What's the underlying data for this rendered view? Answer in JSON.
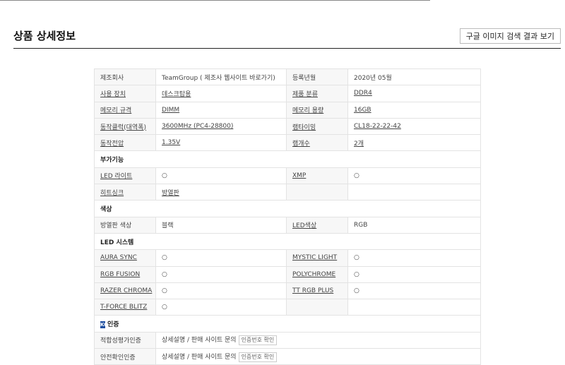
{
  "header": {
    "title": "상품 상세정보",
    "google_button": "구글 이미지 검색 결과 보기"
  },
  "rows": [
    {
      "type": "pair",
      "l1": "제조회사",
      "v1": "TeamGroup ( 제조사 웹사이트 바로가기)",
      "l2": "등록년월",
      "v2": "2020년 05월",
      "l1u": false,
      "v1u": false,
      "l2u": false,
      "v2u": false
    },
    {
      "type": "pair",
      "l1": "사용 장치",
      "v1": "데스크탑용",
      "l2": "제품 분류",
      "v2": "DDR4",
      "l1u": true,
      "v1u": true,
      "l2u": true,
      "v2u": true
    },
    {
      "type": "pair",
      "l1": "메모리 규격",
      "v1": "DIMM",
      "l2": "메모리 용량",
      "v2": "16GB",
      "l1u": true,
      "v1u": true,
      "l2u": true,
      "v2u": true
    },
    {
      "type": "pair",
      "l1": "동작클럭(대역폭)",
      "v1": "3600MHz (PC4-28800)",
      "l2": "램타이밍",
      "v2": "CL18-22-22-42",
      "l1u": true,
      "v1u": true,
      "l2u": true,
      "v2u": true
    },
    {
      "type": "pair",
      "l1": "동작전압",
      "v1": "1.35V",
      "l2": "램개수",
      "v2": "2개",
      "l1u": true,
      "v1u": true,
      "l2u": true,
      "v2u": true
    },
    {
      "type": "section",
      "title": "부가기능"
    },
    {
      "type": "pair",
      "l1": "LED 라이트",
      "v1": "○",
      "l2": "XMP",
      "v2": "○",
      "l1u": true,
      "v1u": false,
      "l2u": true,
      "v2u": false
    },
    {
      "type": "pair",
      "l1": "히트싱크",
      "v1": "방열판",
      "l2": "",
      "v2": "",
      "l1u": true,
      "v1u": true,
      "l2u": false,
      "v2u": false
    },
    {
      "type": "section",
      "title": "색상"
    },
    {
      "type": "pair",
      "l1": "방열판 색상",
      "v1": "블랙",
      "l2": "LED색상",
      "v2": "RGB",
      "l1u": false,
      "v1u": false,
      "l2u": true,
      "v2u": false
    },
    {
      "type": "section",
      "title": "LED 시스템"
    },
    {
      "type": "pair",
      "l1": "AURA SYNC",
      "v1": "○",
      "l2": "MYSTIC LIGHT",
      "v2": "○",
      "l1u": true,
      "v1u": false,
      "l2u": true,
      "v2u": false
    },
    {
      "type": "pair",
      "l1": "RGB FUSION",
      "v1": "○",
      "l2": "POLYCHROME",
      "v2": "○",
      "l1u": true,
      "v1u": false,
      "l2u": true,
      "v2u": false
    },
    {
      "type": "pair",
      "l1": "RAZER CHROMA",
      "v1": "○",
      "l2": "TT RGB PLUS",
      "v2": "○",
      "l1u": true,
      "v1u": false,
      "l2u": true,
      "v2u": false
    },
    {
      "type": "pair",
      "l1": "T-FORCE BLITZ",
      "v1": "○",
      "l2": "",
      "v2": "",
      "l1u": true,
      "v1u": false,
      "l2u": false,
      "v2u": false
    },
    {
      "type": "section",
      "title": "인증",
      "icon": "kc-icon",
      "icon_text": "KC"
    },
    {
      "type": "cert",
      "l1": "적합성평가인증",
      "v1": "상세설명 / 판매 사이트 문의",
      "btn": "인증번호 확인"
    },
    {
      "type": "cert",
      "l1": "안전확인인증",
      "v1": "상세설명 / 판매 사이트 문의",
      "btn": "인증번호 확인"
    }
  ]
}
